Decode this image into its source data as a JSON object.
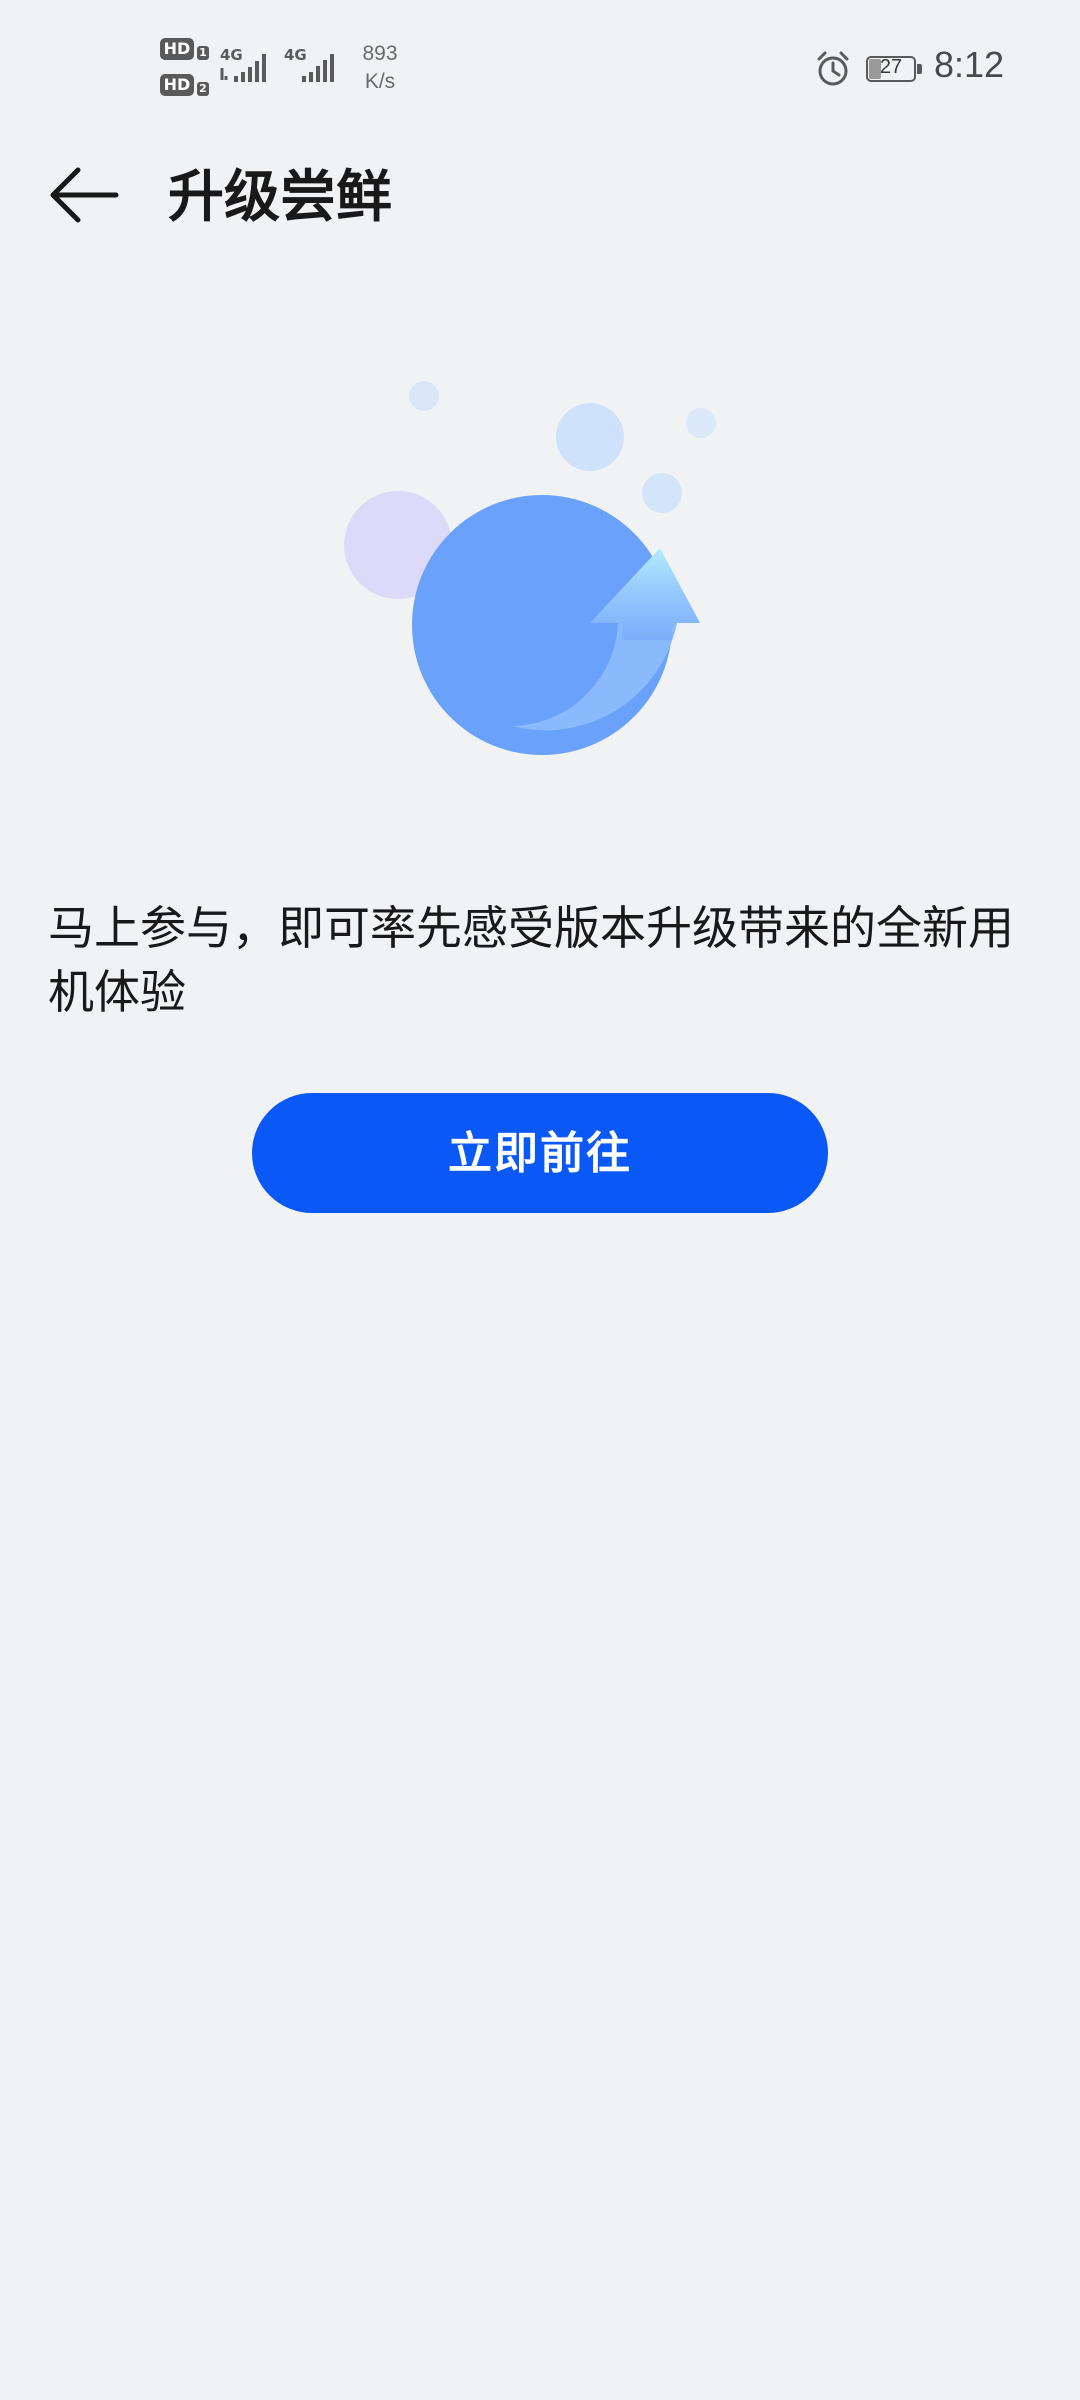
{
  "status_bar": {
    "sim1_hd": "HD",
    "sim1_index": "1",
    "sim2_hd": "HD",
    "sim2_index": "2",
    "sim1_network": "4G",
    "sim2_network": "4G",
    "speed_value": "893",
    "speed_unit": "K/s",
    "alarm_icon": "alarm-clock-icon",
    "battery_level": "27",
    "time": "8:12"
  },
  "header": {
    "back_icon": "arrow-left-icon",
    "title": "升级尝鲜"
  },
  "illustration": {
    "icon": "upgrade-circle-arrow-illustration",
    "colors": {
      "main_circle": "#6aa2fb",
      "purple_bubble": "#dcdaf8",
      "blue_bubble": "#cfe2fb",
      "arrow_light": "#b2ecfd"
    }
  },
  "main": {
    "description": "马上参与，即可率先感受版本升级带来的全新用机体验",
    "button_label": "立即前往"
  },
  "colors": {
    "background": "#f1f2f4",
    "primary_button": "#0a59f7",
    "text_primary": "#191919"
  }
}
